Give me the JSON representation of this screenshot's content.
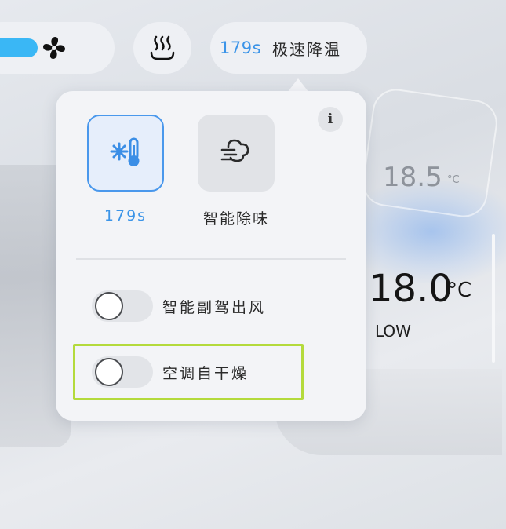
{
  "colors": {
    "accent_blue": "#3b94e8",
    "fan_slider": "#3ab7f5",
    "highlight": "#b4da3c",
    "panel_bg": "#f3f4f7"
  },
  "top_bar": {
    "fan_icon": "fan-icon",
    "heat_icon": "seat-heat-icon",
    "quick_cool_time": "179s",
    "quick_cool_label": "极速降温"
  },
  "readouts": {
    "rear_temp": "18.5",
    "rear_unit": "°C",
    "main_temp": "18.0",
    "main_unit": "°C",
    "fan_level": "LOW"
  },
  "popup": {
    "info_label": "i",
    "modes": [
      {
        "label": "179s",
        "icon": "snowflake-thermometer-icon",
        "active": true
      },
      {
        "label": "智能除味",
        "icon": "airflow-icon",
        "active": false
      }
    ],
    "toggles": [
      {
        "label": "智能副驾出风",
        "on": false
      },
      {
        "label": "空调自干燥",
        "on": false
      }
    ]
  }
}
